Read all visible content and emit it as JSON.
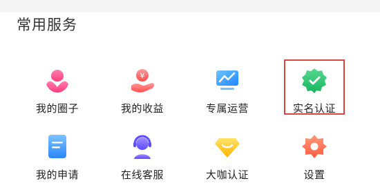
{
  "section": {
    "title": "常用服务"
  },
  "services": [
    {
      "label": "我的圈子",
      "icon": "circle-group-icon",
      "color": "#ff4f8b"
    },
    {
      "label": "我的收益",
      "icon": "income-yen-icon",
      "color": "#ff5a5a"
    },
    {
      "label": "专属运营",
      "icon": "operations-chart-icon",
      "color": "#2f9bff"
    },
    {
      "label": "实名认证",
      "icon": "verified-badge-icon",
      "color": "#27c27a"
    },
    {
      "label": "我的申请",
      "icon": "application-doc-icon",
      "color": "#3b8cff"
    },
    {
      "label": "在线客服",
      "icon": "customer-service-icon",
      "color": "#6b5cff"
    },
    {
      "label": "大咖认证",
      "icon": "expert-diamond-icon",
      "color": "#ffc21a"
    },
    {
      "label": "设置",
      "icon": "settings-gear-icon",
      "color": "#ff6a4d"
    }
  ],
  "highlight": {
    "target": "实名认证",
    "color": "#d9463d"
  }
}
